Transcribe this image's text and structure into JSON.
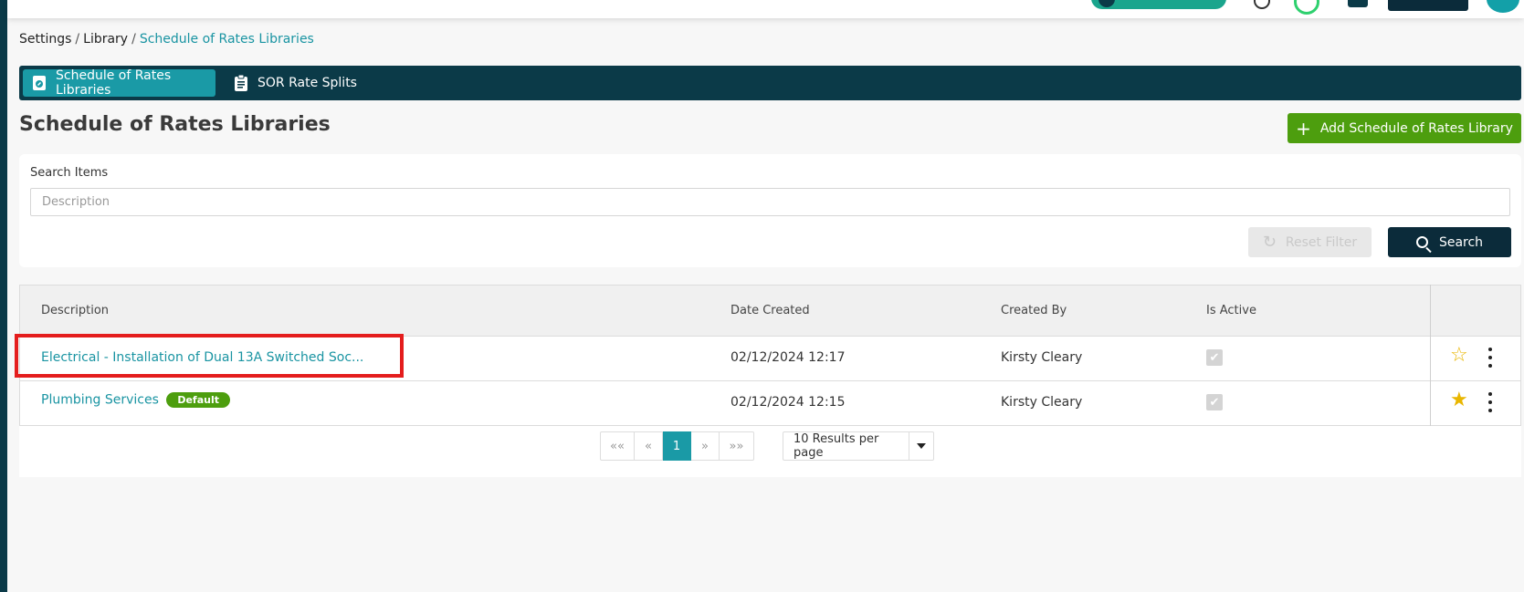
{
  "breadcrumb": {
    "items": [
      "Settings",
      "Library"
    ],
    "current": "Schedule of Rates Libraries"
  },
  "tabs": [
    {
      "label": "Schedule of Rates Libraries",
      "icon": "library-icon",
      "active": true
    },
    {
      "label": "SOR Rate Splits",
      "icon": "clipboard-icon",
      "active": false
    }
  ],
  "page": {
    "title": "Schedule of Rates Libraries",
    "add_button_label": "Add Schedule of Rates Library"
  },
  "filter": {
    "label": "Search Items",
    "placeholder": "Description",
    "reset_label": "Reset Filter",
    "search_label": "Search"
  },
  "table": {
    "columns": [
      "Description",
      "Date Created",
      "Created By",
      "Is Active"
    ],
    "rows": [
      {
        "description": "Electrical - Installation of Dual 13A Switched Soc...",
        "badge": "",
        "date_created": "02/12/2024 12:17",
        "created_by": "Kirsty Cleary",
        "is_active": true,
        "favourite": false
      },
      {
        "description": "Plumbing Services",
        "badge": "Default",
        "date_created": "02/12/2024 12:15",
        "created_by": "Kirsty Cleary",
        "is_active": true,
        "favourite": true
      }
    ]
  },
  "pagination": {
    "first": "««",
    "prev": "«",
    "current": "1",
    "next": "»",
    "last": "»»",
    "per_page": "10 Results per page"
  },
  "colors": {
    "nav_dark": "#0b3a48",
    "accent_teal": "#1a9aa6",
    "success_green": "#4d9e0e",
    "highlight_red": "#e41d1d",
    "star_gold": "#e9b600"
  }
}
